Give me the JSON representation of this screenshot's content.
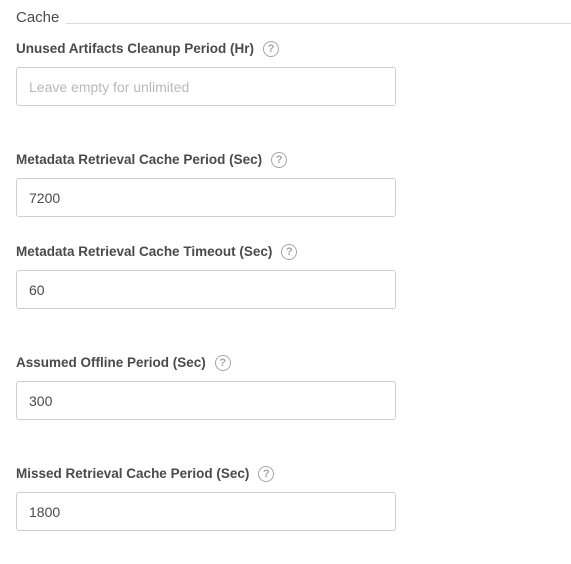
{
  "section": {
    "title": "Cache"
  },
  "fields": [
    {
      "label": "Unused Artifacts Cleanup Period (Hr)",
      "value": "",
      "placeholder": "Leave empty for unlimited"
    },
    {
      "label": "Metadata Retrieval Cache Period (Sec)",
      "value": "7200",
      "placeholder": ""
    },
    {
      "label": "Metadata Retrieval Cache Timeout (Sec)",
      "value": "60",
      "placeholder": ""
    },
    {
      "label": "Assumed Offline Period (Sec)",
      "value": "300",
      "placeholder": ""
    },
    {
      "label": "Missed Retrieval Cache Period (Sec)",
      "value": "1800",
      "placeholder": ""
    }
  ],
  "help_icon": {
    "glyph": "?",
    "name": "help-icon"
  }
}
